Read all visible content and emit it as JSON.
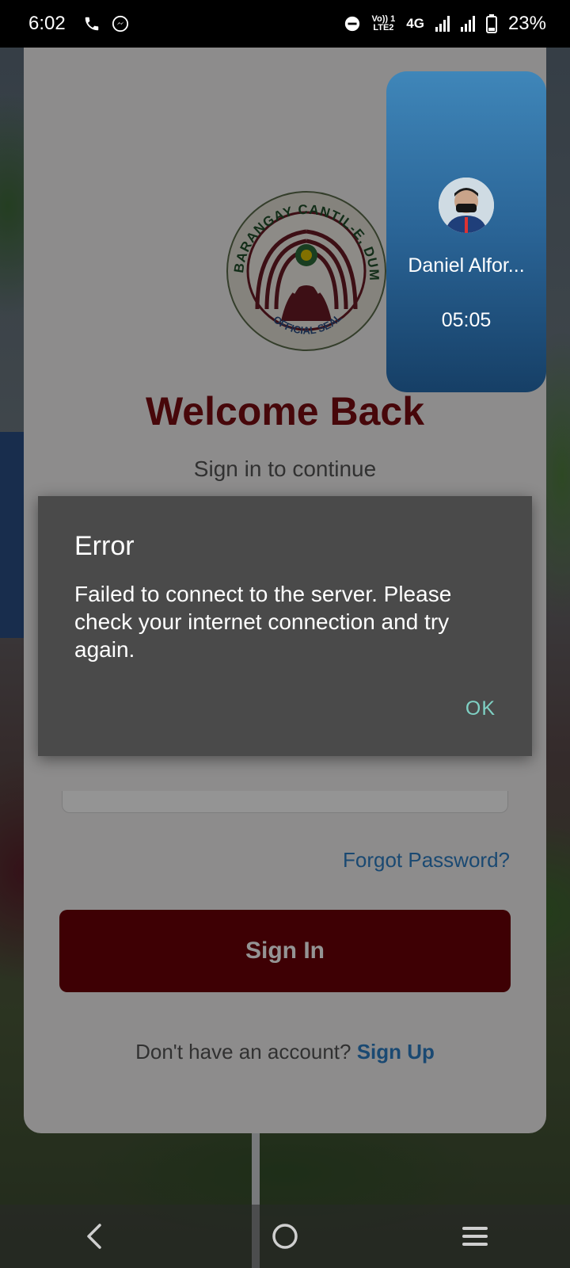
{
  "status_bar": {
    "time": "6:02",
    "volte_top": "Vo)) 1",
    "volte_bottom": "LTE2",
    "network": "4G",
    "battery": "23%"
  },
  "login": {
    "seal_top_text": "BARANGAY CANTIL-E, DUMAGUETE CITY",
    "seal_bottom_text": "OFFICIAL SEAL",
    "welcome": "Welcome Back",
    "subtitle": "Sign in to continue",
    "forgot_password": "Forgot Password?",
    "sign_in": "Sign In",
    "no_account": "Don't have an account?",
    "sign_up": "Sign Up"
  },
  "call_bubble": {
    "name": "Daniel Alfor...",
    "duration": "05:05"
  },
  "dialog": {
    "title": "Error",
    "message": "Failed to connect to the server. Please check your internet connection and try again.",
    "ok": "OK"
  },
  "colors": {
    "brand_maroon": "#7a0d12",
    "link_blue": "#2e7fc4",
    "dialog_bg": "#4a4a4a",
    "dialog_accent": "#7fd1c4"
  },
  "icons": {
    "status_left": [
      "phone-icon",
      "messenger-icon"
    ],
    "status_right": [
      "do-not-disturb-icon",
      "signal-icon",
      "battery-icon"
    ],
    "nav": [
      "back-icon",
      "home-icon",
      "recents-icon"
    ]
  }
}
